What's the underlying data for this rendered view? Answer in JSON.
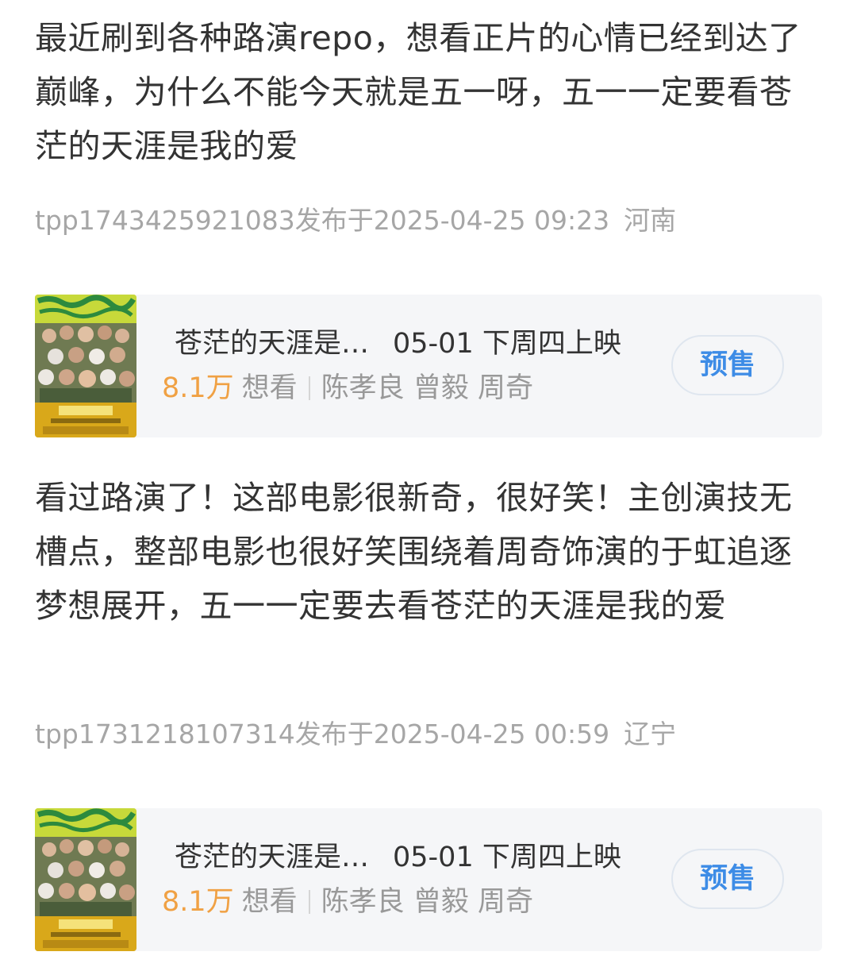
{
  "posts": [
    {
      "text": "最近刷到各种路演repo，想看正片的心情已经到达了巅峰，为什么不能今天就是五一呀，五一一定要看苍茫的天涯是我的爱",
      "meta": "tpp1743425921083发布于2025-04-25 09:23",
      "region": "河南",
      "movie": {
        "title": "苍茫的天涯是…",
        "release": "05-01 下周四上映",
        "want_count": "8.1万",
        "want_label": "想看",
        "cast": "陈孝良 曾毅 周奇",
        "button": "预售"
      }
    },
    {
      "text": "看过路演了！这部电影很新奇，很好笑！主创演技无槽点，整部电影也很好笑围绕着周奇饰演的于虹追逐梦想展开，五一一定要去看苍茫的天涯是我的爱",
      "meta": "tpp1731218107314发布于2025-04-25 00:59",
      "region": "辽宁",
      "movie": {
        "title": "苍茫的天涯是…",
        "release": "05-01 下周四上映",
        "want_count": "8.1万",
        "want_label": "想看",
        "cast": "陈孝良 曾毅 周奇",
        "button": "预售"
      }
    }
  ],
  "colors": {
    "text": "#333333",
    "meta": "#a6a6a6",
    "card_bg": "#f5f6f8",
    "want_count": "#f0a144",
    "button_text": "#3d8ce6",
    "poster_green": "#3aa34a",
    "poster_yellow": "#e8c21a"
  }
}
